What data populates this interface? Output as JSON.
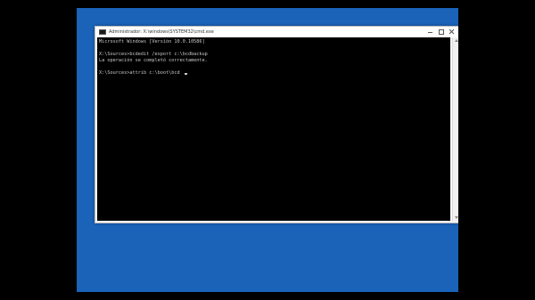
{
  "window": {
    "title": "Administrador: X:\\windows\\SYSTEM32\\cmd.exe"
  },
  "console": {
    "lines": [
      "Microsoft Windows [Versión 10.0.10586]",
      "",
      "X:\\Sources>bcdedit /export c:\\bcdbackup",
      "La operación se completó correctamente.",
      "",
      "X:\\Sources>attrib c:\\boot\\bcd "
    ]
  },
  "colors": {
    "screen_background": "#1a63b8",
    "console_background": "#000000",
    "console_text": "#c8c8c8"
  }
}
